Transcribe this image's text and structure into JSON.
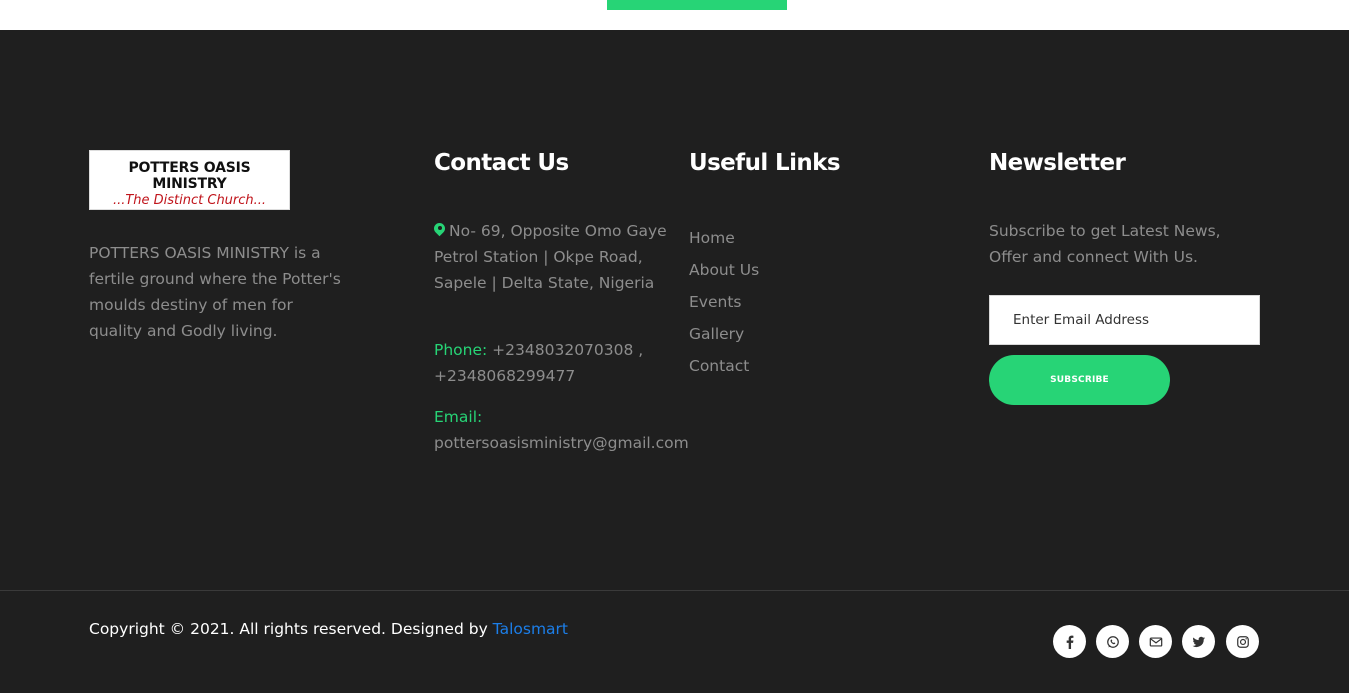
{
  "brand": {
    "logo_line1": "POTTERS OASIS MINISTRY",
    "logo_line2": "...The Distinct Church...",
    "about": "POTTERS OASIS MINISTRY is a fertile ground where the Potter's moulds destiny of men for quality and Godly living."
  },
  "contact": {
    "heading": "Contact Us",
    "address": "No- 69, Opposite Omo Gaye Petrol Station | Okpe Road, Sapele | Delta State, Nigeria",
    "phone_label": "Phone:",
    "phone_value": " +2348032070308 , +2348068299477",
    "email_label": "Email:",
    "email_value": "pottersoasisministry@gmail.com"
  },
  "links": {
    "heading": "Useful Links",
    "items": [
      "Home",
      "About Us",
      "Events",
      "Gallery",
      "Contact"
    ]
  },
  "newsletter": {
    "heading": "Newsletter",
    "text": "Subscribe to get Latest News, Offer and connect With Us.",
    "placeholder": "Enter Email Address",
    "button": "SUBSCRIBE"
  },
  "footer": {
    "copyright": "Copyright © 2021. All rights reserved. Designed by ",
    "designer": "Talosmart"
  },
  "social": [
    "facebook-icon",
    "whatsapp-icon",
    "envelope-icon",
    "twitter-icon",
    "instagram-icon"
  ],
  "colors": {
    "accent": "#27d476",
    "background": "#1f1f1f",
    "link_blue": "#1c7ee8"
  }
}
